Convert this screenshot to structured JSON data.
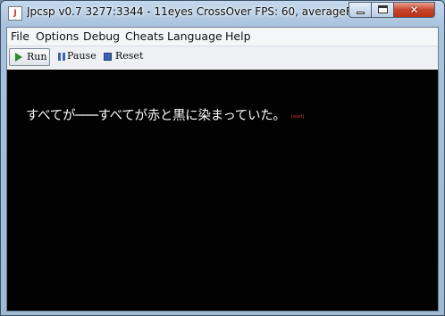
{
  "window": {
    "title": "Jpcsp v0.7 3277:3344 - 11eyes CrossOver FPS: 60, averageFPS...",
    "app_icon": "java-icon",
    "controls": {
      "minimize": "minimize-icon",
      "maximize": "maximize-icon",
      "close_glyph": "✕"
    }
  },
  "menu": {
    "items": [
      {
        "label": "File"
      },
      {
        "label": "Options"
      },
      {
        "label": "Debug"
      },
      {
        "label": "Cheats"
      },
      {
        "label": "Language"
      },
      {
        "label": "Help"
      }
    ]
  },
  "toolbar": {
    "run_label": "Run",
    "pause_label": "Pause",
    "reset_label": "Reset"
  },
  "screen": {
    "subtitle": "すべてが───すべてが赤と黒に染まっていた。",
    "tag": "[wait]"
  },
  "colors": {
    "accent_play": "#2e8b2e",
    "accent_icons": "#3d63b0",
    "close": "#c8452c"
  }
}
